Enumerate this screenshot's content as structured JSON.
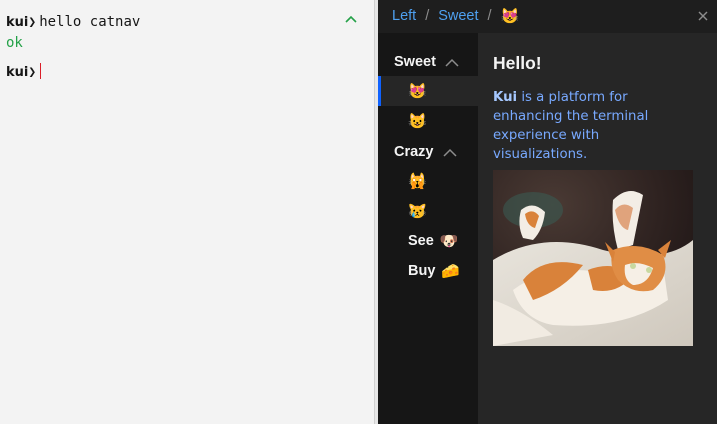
{
  "terminal": {
    "prompt": "kui",
    "prompt_chevron": "❯",
    "command": "hello catnav",
    "output": "ok"
  },
  "sidecar": {
    "breadcrumb": {
      "left": "Left",
      "sweet": "Sweet",
      "current_emoji": "😻"
    },
    "nav": {
      "sweet": {
        "label": "Sweet",
        "items": [
          {
            "emoji": "😻"
          },
          {
            "emoji": "😺"
          }
        ]
      },
      "crazy": {
        "label": "Crazy",
        "items": [
          {
            "emoji": "🙀"
          },
          {
            "emoji": "😿"
          },
          {
            "label": "See",
            "emoji": "🐶"
          },
          {
            "label": "Buy",
            "emoji": "🧀"
          }
        ]
      }
    },
    "content": {
      "title": "Hello!",
      "desc_strong": "Kui",
      "desc_rest": " is a platform for enhancing the terminal experience with visualizations."
    }
  },
  "colors": {
    "terminal_bg": "#f3f3f3",
    "sidecar_bg": "#262626",
    "nav_bg": "#161616",
    "link": "#4ea0f0",
    "ok_green": "#24a148",
    "desc_blue": "#78a9ff",
    "selection_bar": "#0f62fe"
  },
  "icons": [
    "chevron-up-icon",
    "close-icon"
  ]
}
